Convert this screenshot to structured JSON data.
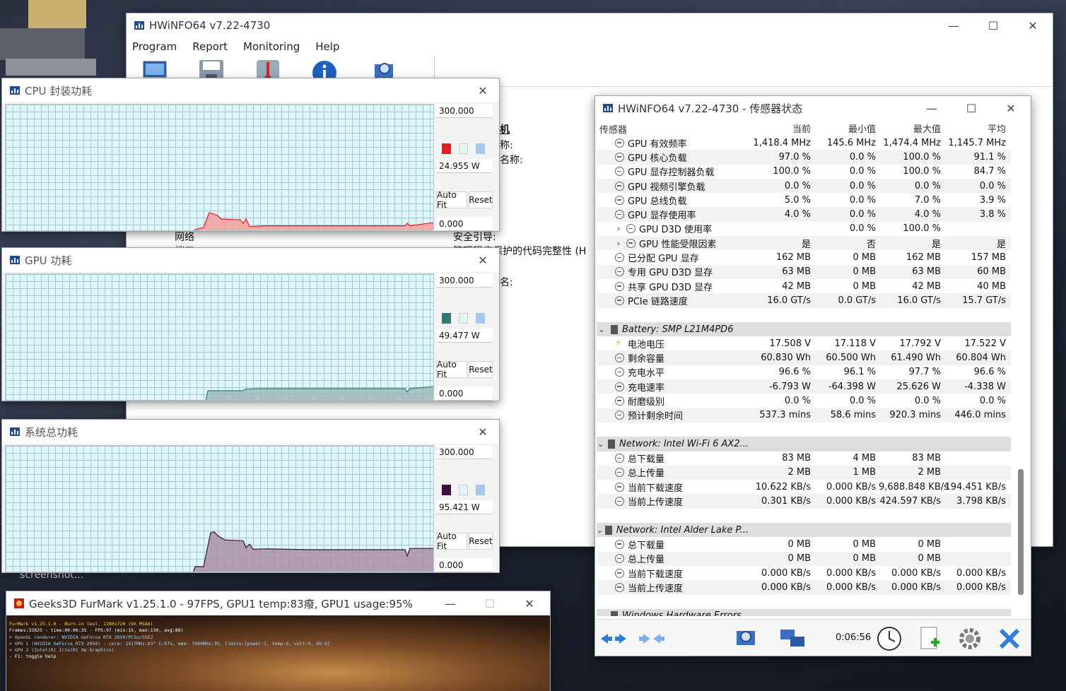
{
  "main_window": {
    "title": "HWiNFO64 v7.22-4730",
    "menu": [
      "Program",
      "Report",
      "Monitoring",
      "Help"
    ],
    "toolbar_icons": [
      "computer-icon",
      "save-icon",
      "thermometer-icon",
      "info-icon",
      "sensor-monitor-icon"
    ],
    "texts": [
      "机",
      "称:",
      "名称:",
      "安全引导:",
      "管理程序保护的代码完整性 (H",
      "名:",
      "网络",
      "端口"
    ]
  },
  "graph_windows": [
    {
      "title": "CPU 封装功耗",
      "max": "300.000",
      "current": "24.955 W",
      "min": "0.000",
      "color": "#e31c1c",
      "fill": "#f4a0a0",
      "autofit": "Auto Fit",
      "reset": "Reset",
      "trace": [
        0,
        0,
        0,
        0,
        0,
        0,
        0,
        0,
        0,
        0,
        0,
        0,
        0,
        0,
        0,
        0,
        0,
        0,
        0,
        0,
        0,
        0,
        0,
        0,
        0,
        0,
        0,
        0,
        0,
        0,
        0,
        0,
        0,
        0,
        0,
        0,
        0,
        0,
        0,
        0,
        0,
        0,
        0,
        0,
        0,
        0,
        0,
        0,
        0,
        0,
        0,
        0,
        0,
        0,
        0,
        0,
        0,
        0,
        0,
        0,
        0,
        0,
        0,
        0,
        0,
        0,
        0,
        0,
        0,
        0,
        0,
        0,
        0,
        0,
        0,
        0,
        0,
        0,
        0,
        0,
        0,
        0,
        0,
        0,
        0,
        0,
        0,
        0,
        0,
        0,
        0,
        0,
        0,
        0,
        0,
        0,
        0,
        0,
        0,
        0,
        0,
        0,
        0,
        0,
        0,
        0,
        0,
        0,
        0,
        0,
        0,
        0,
        0,
        0,
        0,
        0,
        0,
        0,
        0,
        0,
        0,
        0,
        0,
        0,
        0,
        0,
        0,
        0,
        0,
        0,
        0,
        0,
        0,
        0,
        0,
        0,
        0,
        0,
        0,
        0,
        0,
        0,
        0,
        0,
        0,
        0,
        0,
        0,
        0,
        0,
        0,
        0,
        0,
        0,
        0,
        0,
        0,
        0,
        0,
        0,
        0,
        0,
        0,
        0,
        0,
        0,
        0,
        0,
        0,
        0,
        0,
        0,
        0,
        0,
        0,
        0,
        0,
        0,
        0,
        0,
        0,
        0,
        0,
        0,
        0,
        0,
        0,
        0,
        0,
        0,
        0,
        0,
        0,
        0,
        0,
        0,
        0,
        0,
        0,
        0,
        0,
        0,
        0,
        0,
        0,
        0,
        0,
        0,
        0,
        0,
        0,
        0,
        0,
        0,
        0,
        0,
        0,
        0,
        0,
        0,
        0,
        0,
        0,
        0,
        0,
        0,
        0,
        0,
        0,
        0,
        0,
        0,
        0,
        0,
        0,
        0,
        0,
        0,
        0,
        0,
        0,
        0,
        0,
        0,
        0,
        0,
        0,
        0,
        0,
        0,
        0,
        0,
        0,
        0,
        0,
        0,
        0,
        0,
        0,
        0,
        0,
        0,
        0,
        0,
        0,
        0,
        0,
        0,
        0,
        0,
        0,
        0,
        0,
        0,
        0,
        0,
        0,
        0,
        0,
        0,
        0,
        0,
        0,
        0,
        0,
        0,
        0,
        0,
        0,
        0,
        0,
        0,
        0,
        0,
        0,
        0,
        0,
        0,
        0,
        0,
        0,
        0,
        0,
        0,
        0,
        0,
        0,
        0,
        0,
        0,
        0,
        0,
        0,
        0,
        0,
        0,
        0,
        0,
        0,
        0,
        0,
        0,
        0,
        0,
        0,
        0,
        0,
        0,
        0,
        0,
        0,
        0,
        0,
        0,
        0,
        0,
        0,
        0,
        0,
        0,
        0,
        0,
        0,
        0,
        0,
        0,
        0,
        0,
        0,
        0,
        0,
        0,
        0,
        0,
        0,
        0,
        0,
        0,
        0,
        0,
        0,
        0,
        0,
        0,
        0,
        0,
        0,
        0,
        0,
        0,
        0,
        0,
        0,
        0,
        0,
        0,
        0,
        0,
        0,
        0,
        0,
        0,
        0,
        0,
        0,
        0,
        0,
        0,
        0,
        0,
        0,
        0,
        0,
        0,
        0,
        0,
        0,
        0,
        0,
        0,
        0,
        0,
        0,
        0,
        0,
        0,
        0,
        0,
        0,
        0,
        0,
        0,
        0,
        0,
        0,
        0,
        0,
        0,
        0,
        0,
        0,
        0,
        0,
        0,
        0,
        0,
        0,
        0,
        0,
        0,
        0,
        0,
        0,
        0,
        0,
        0,
        0,
        0,
        0,
        0,
        0,
        0,
        0,
        0,
        0,
        0,
        0,
        0,
        0,
        0,
        0,
        0,
        0,
        0,
        0,
        0,
        0,
        0,
        0,
        0,
        0,
        0,
        0,
        0,
        0,
        0,
        0,
        0,
        0,
        0,
        0,
        0,
        0,
        0,
        0,
        0,
        0,
        0,
        0,
        0,
        0,
        0,
        0,
        0,
        0,
        0,
        0,
        0,
        0,
        0,
        0,
        0,
        0,
        0,
        0,
        0,
        0,
        0,
        0,
        0,
        0,
        0,
        0,
        0,
        0,
        0,
        0,
        0,
        0,
        0,
        0,
        0,
        0,
        0,
        0,
        0,
        0,
        0,
        0,
        0,
        0,
        0,
        0,
        0,
        0,
        0,
        0,
        0,
        0,
        0,
        0,
        0,
        0,
        0,
        0,
        0,
        0,
        0,
        0,
        0,
        0,
        0,
        0,
        0,
        0,
        0,
        0,
        0,
        0,
        0,
        0,
        0,
        0,
        0,
        0,
        0,
        0,
        0,
        0,
        0,
        0,
        0,
        0,
        0,
        0,
        0,
        0,
        0,
        0,
        0,
        0,
        0,
        0,
        0,
        0,
        0,
        0,
        0,
        0,
        0,
        0,
        0,
        0,
        0,
        0,
        0,
        0,
        0,
        0,
        0,
        0,
        0,
        0,
        0,
        0,
        0,
        0,
        0,
        0,
        0,
        0,
        0,
        0,
        0,
        0,
        0,
        0,
        0,
        0,
        0,
        0,
        0,
        0,
        0,
        0,
        0,
        0,
        0,
        0,
        0,
        0,
        0,
        0,
        0,
        0,
        0,
        0,
        0,
        0,
        0,
        0,
        0,
        0,
        0,
        0,
        0,
        0,
        0,
        0,
        0,
        0,
        0,
        0,
        0,
        0,
        0,
        0,
        0,
        0,
        0
      ]
    },
    {
      "title": "GPU 功耗",
      "max": "300.000",
      "current": "49.477 W",
      "min": "0.000",
      "color": "#2e7a74",
      "fill": "#9fb8b8",
      "autofit": "Auto Fit",
      "reset": "Reset"
    },
    {
      "title": "系统总功耗",
      "max": "300.000",
      "current": "95.421 W",
      "min": "0.000",
      "color": "#3d0d3d",
      "fill": "#a990a8",
      "autofit": "Auto Fit",
      "reset": "Reset"
    }
  ],
  "sensor_window": {
    "title": "HWiNFO64 v7.22-4730 - 传感器状态",
    "columns": [
      "传感器",
      "当前",
      "最小值",
      "最大值",
      "平均"
    ],
    "rows": [
      {
        "k": "s",
        "n": "GPU 有效频率",
        "c": "1,418.4 MHz",
        "mn": "145.6 MHz",
        "mx": "1,474.4 MHz",
        "a": "1,145.7 MHz"
      },
      {
        "k": "s",
        "n": "GPU 核心负载",
        "c": "97.0 %",
        "mn": "0.0 %",
        "mx": "100.0 %",
        "a": "91.1 %"
      },
      {
        "k": "s",
        "n": "GPU 显存控制器负载",
        "c": "100.0 %",
        "mn": "0.0 %",
        "mx": "100.0 %",
        "a": "84.7 %"
      },
      {
        "k": "s",
        "n": "GPU 视频引擎负载",
        "c": "0.0 %",
        "mn": "0.0 %",
        "mx": "0.0 %",
        "a": "0.0 %"
      },
      {
        "k": "s",
        "n": "GPU 总线负载",
        "c": "5.0 %",
        "mn": "0.0 %",
        "mx": "7.0 %",
        "a": "3.9 %"
      },
      {
        "k": "s",
        "n": "GPU 显存使用率",
        "c": "4.0 %",
        "mn": "0.0 %",
        "mx": "4.0 %",
        "a": "3.8 %"
      },
      {
        "k": "x",
        "n": "GPU D3D 使用率",
        "c": "",
        "mn": "0.0 %",
        "mx": "100.0 %",
        "a": ""
      },
      {
        "k": "x",
        "n": "GPU 性能受限因素",
        "c": "是",
        "mn": "否",
        "mx": "是",
        "a": "是"
      },
      {
        "k": "s",
        "n": "已分配 GPU 显存",
        "c": "162 MB",
        "mn": "0 MB",
        "mx": "162 MB",
        "a": "157 MB"
      },
      {
        "k": "s",
        "n": "专用 GPU D3D 显存",
        "c": "63 MB",
        "mn": "0 MB",
        "mx": "63 MB",
        "a": "60 MB"
      },
      {
        "k": "s",
        "n": "共享 GPU D3D 显存",
        "c": "42 MB",
        "mn": "0 MB",
        "mx": "42 MB",
        "a": "40 MB"
      },
      {
        "k": "s",
        "n": "PCIe 链路速度",
        "c": "16.0 GT/s",
        "mn": "0.0 GT/s",
        "mx": "16.0 GT/s",
        "a": "15.7 GT/s"
      },
      {
        "k": "e"
      },
      {
        "k": "g",
        "n": "Battery: SMP L21M4PD6"
      },
      {
        "k": "b",
        "n": "电池电压",
        "c": "17.508 V",
        "mn": "17.118 V",
        "mx": "17.792 V",
        "a": "17.522 V"
      },
      {
        "k": "s",
        "n": "剩余容量",
        "c": "60.830 Wh",
        "mn": "60.500 Wh",
        "mx": "61.490 Wh",
        "a": "60.804 Wh"
      },
      {
        "k": "s",
        "n": "充电水平",
        "c": "96.6 %",
        "mn": "96.1 %",
        "mx": "97.7 %",
        "a": "96.6 %"
      },
      {
        "k": "s",
        "n": "充电速率",
        "c": "-6.793 W",
        "mn": "-64.398 W",
        "mx": "25.626 W",
        "a": "-4.338 W"
      },
      {
        "k": "s",
        "n": "耐磨级别",
        "c": "0.0 %",
        "mn": "0.0 %",
        "mx": "0.0 %",
        "a": "0.0 %"
      },
      {
        "k": "s",
        "n": "预计剩余时间",
        "c": "537.3 mins",
        "mn": "58.6 mins",
        "mx": "920.3 mins",
        "a": "446.0 mins"
      },
      {
        "k": "e"
      },
      {
        "k": "g",
        "n": "Network: Intel Wi-Fi 6 AX2..."
      },
      {
        "k": "s",
        "n": "总下载量",
        "c": "83 MB",
        "mn": "4 MB",
        "mx": "83 MB",
        "a": ""
      },
      {
        "k": "s",
        "n": "总上传量",
        "c": "2 MB",
        "mn": "1 MB",
        "mx": "2 MB",
        "a": ""
      },
      {
        "k": "s",
        "n": "当前下载速度",
        "c": "10.622 KB/s",
        "mn": "0.000 KB/s",
        "mx": "9,688.848 KB/s",
        "a": "194.451 KB/s"
      },
      {
        "k": "s",
        "n": "当前上传速度",
        "c": "0.301 KB/s",
        "mn": "0.000 KB/s",
        "mx": "424.597 KB/s",
        "a": "3.798 KB/s"
      },
      {
        "k": "e"
      },
      {
        "k": "g",
        "n": "Network: Intel Alder Lake P..."
      },
      {
        "k": "s",
        "n": "总下载量",
        "c": "0 MB",
        "mn": "0 MB",
        "mx": "0 MB",
        "a": ""
      },
      {
        "k": "s",
        "n": "总上传量",
        "c": "0 MB",
        "mn": "0 MB",
        "mx": "0 MB",
        "a": ""
      },
      {
        "k": "s",
        "n": "当前下载速度",
        "c": "0.000 KB/s",
        "mn": "0.000 KB/s",
        "mx": "0.000 KB/s",
        "a": "0.000 KB/s"
      },
      {
        "k": "s",
        "n": "当前上传速度",
        "c": "0.000 KB/s",
        "mn": "0.000 KB/s",
        "mx": "0.000 KB/s",
        "a": "0.000 KB/s"
      },
      {
        "k": "e"
      },
      {
        "k": "g",
        "n": "Windows Hardware Errors"
      }
    ],
    "timer": "0:06:56"
  },
  "furmark": {
    "title": "Geeks3D FurMark v1.25.1.0 - 97FPS, GPU1 temp:83癈, GPU1 usage:95%",
    "lines": [
      "FurMark v1.25.1.0 - Burn-in test, 1280x720 (0X MSAA)",
      "Frames:33825 - time:00:06:35 - FPS:97 (min:15, max:130, avg:86)",
      "> OpenGL renderer: NVIDIA GeForce RTX 2050/PCIe/SSE2",
      "> GPU 1 (NVIDIA GeForce RTX 2050) - core: 1417MHz:83° C:97%, mem: 7000MHz:3%, limits:[power:1, temp:0, volt:0, OV:0]",
      "> GPU 2 (Intel(R) Iris(R) Xe Graphics)",
      "- F1: toggle help"
    ]
  },
  "desktop_label": "screenshot..."
}
